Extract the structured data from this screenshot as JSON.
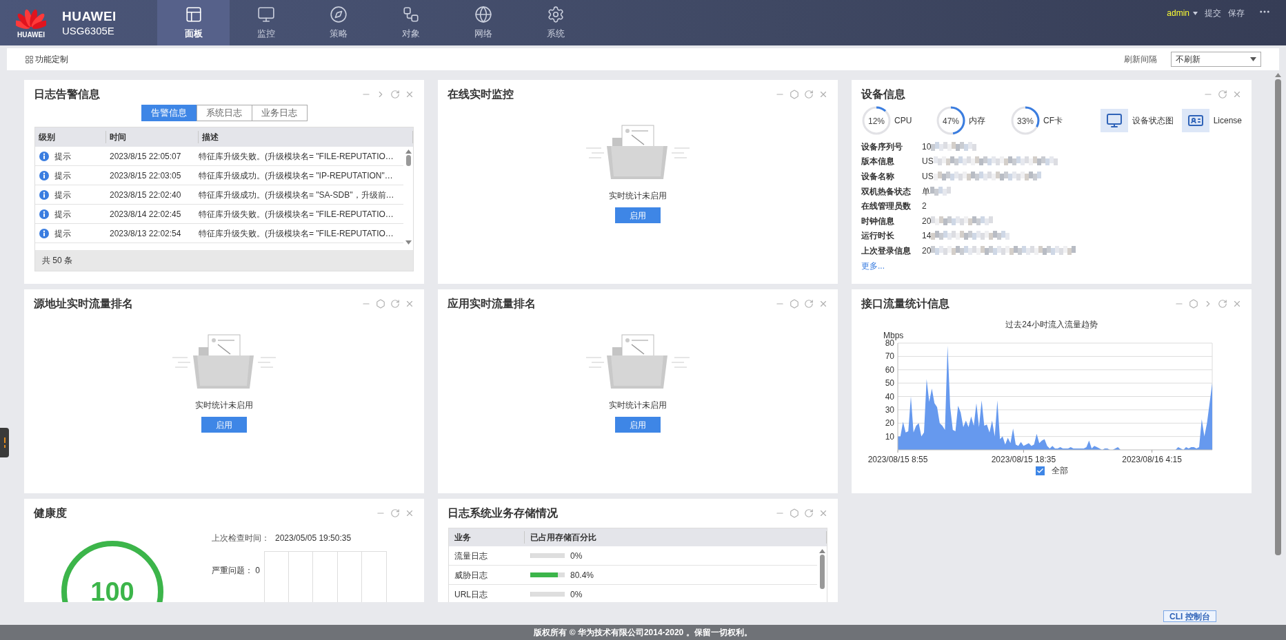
{
  "header": {
    "logo_caption": "HUAWEI",
    "brand": "HUAWEI",
    "model": "USG6305E",
    "nav": [
      {
        "label": "面板",
        "kind": "dashboard",
        "selected": true
      },
      {
        "label": "监控",
        "kind": "monitor",
        "selected": false
      },
      {
        "label": "策略",
        "kind": "policy",
        "selected": false
      },
      {
        "label": "对象",
        "kind": "object",
        "selected": false
      },
      {
        "label": "网络",
        "kind": "network",
        "selected": false
      },
      {
        "label": "系统",
        "kind": "system",
        "selected": false
      }
    ],
    "user": "admin",
    "actions": [
      "提交",
      "保存"
    ]
  },
  "toolbar": {
    "customize": "功能定制",
    "refresh_label": "刷新间隔",
    "refresh_value": "不刷新"
  },
  "panels": [
    {
      "kind": "log",
      "title": "日志告警信息",
      "tools": [
        {
          "kind": "minimize"
        },
        {
          "kind": "next"
        },
        {
          "kind": "refresh"
        },
        {
          "kind": "close"
        }
      ],
      "tabs": [
        {
          "label": "告警信息",
          "selected": true
        },
        {
          "label": "系统日志",
          "selected": false
        },
        {
          "label": "业务日志",
          "selected": false
        }
      ],
      "columns": [
        "级别",
        "时间",
        "描述"
      ],
      "rows": [
        {
          "level": "提示",
          "time": "2023/8/15 22:05:07",
          "description": "特征库升级失败。(升级模块名= \"FILE-REPUTATIO…"
        },
        {
          "level": "提示",
          "time": "2023/8/15 22:03:05",
          "description": "特征库升级成功。(升级模块名= \"IP-REPUTATION\"…"
        },
        {
          "level": "提示",
          "time": "2023/8/15 22:02:40",
          "description": "特征库升级成功。(升级模块名= \"SA-SDB\"，升级前…"
        },
        {
          "level": "提示",
          "time": "2023/8/14 22:02:45",
          "description": "特征库升级失败。(升级模块名= \"FILE-REPUTATIO…"
        },
        {
          "level": "提示",
          "time": "2023/8/13 22:02:54",
          "description": "特征库升级失败。(升级模块名= \"FILE-REPUTATIO…"
        }
      ],
      "total": "共 50 条"
    },
    {
      "kind": "empty",
      "title": "在线实时监控",
      "tools": [
        {
          "kind": "minimize"
        },
        {
          "kind": "settings"
        },
        {
          "kind": "refresh"
        },
        {
          "kind": "close"
        }
      ],
      "message": "实时统计未启用",
      "button": "启用"
    },
    {
      "kind": "device",
      "title": "设备信息",
      "tools": [
        {
          "kind": "minimize"
        },
        {
          "kind": "refresh"
        },
        {
          "kind": "close"
        }
      ],
      "gauges": [
        {
          "value": "12%",
          "label": "CPU",
          "level": 0.12
        },
        {
          "value": "47%",
          "label": "内存",
          "level": 0.47
        },
        {
          "value": "33%",
          "label": "CF卡",
          "level": 0.33
        }
      ],
      "shortcuts": [
        {
          "label": "设备状态图",
          "kind": "monitor"
        },
        {
          "label": "License",
          "kind": "license"
        }
      ],
      "info": [
        {
          "label": "设备序列号",
          "value": "10",
          "redacted": true
        },
        {
          "label": "版本信息",
          "value": "US",
          "redacted": true
        },
        {
          "label": "设备名称",
          "value": "US",
          "redacted": true
        },
        {
          "label": "双机热备状态",
          "value": "单",
          "redacted": true
        },
        {
          "label": "在线管理员数",
          "value": "2",
          "redacted": false
        },
        {
          "label": "时钟信息",
          "value": "20",
          "redacted": true
        },
        {
          "label": "运行时长",
          "value": "14",
          "redacted": true
        },
        {
          "label": "上次登录信息",
          "value": "20",
          "redacted": true
        }
      ],
      "more": "更多..."
    },
    {
      "kind": "empty",
      "title": "源地址实时流量排名",
      "tools": [
        {
          "kind": "minimize"
        },
        {
          "kind": "settings"
        },
        {
          "kind": "refresh"
        },
        {
          "kind": "close"
        }
      ],
      "message": "实时统计未启用",
      "button": "启用"
    },
    {
      "kind": "empty",
      "title": "应用实时流量排名",
      "tools": [
        {
          "kind": "minimize"
        },
        {
          "kind": "settings"
        },
        {
          "kind": "refresh"
        },
        {
          "kind": "close"
        }
      ],
      "message": "实时统计未启用",
      "button": "启用"
    },
    {
      "kind": "chart",
      "title": "接口流量统计信息",
      "tools": [
        {
          "kind": "minimize"
        },
        {
          "kind": "settings"
        },
        {
          "kind": "next"
        },
        {
          "kind": "refresh"
        },
        {
          "kind": "close"
        }
      ],
      "legend_checked": true,
      "chart_data": {
        "type": "area",
        "title": "过去24小时流入流量趋势",
        "ylabel": "Mbps",
        "ylim": [
          0,
          80
        ],
        "yticks": [
          10,
          20,
          30,
          40,
          50,
          60,
          70,
          80
        ],
        "grid": true,
        "categories": [
          "2023/08/15 8:55",
          null,
          null,
          null,
          null,
          null,
          null,
          null,
          null,
          null,
          null,
          null,
          null,
          null,
          null,
          null,
          null,
          null,
          null,
          null,
          null,
          null,
          null,
          null,
          null,
          null,
          null,
          null,
          null,
          null,
          null,
          null,
          null,
          null,
          null,
          null,
          null,
          null,
          null,
          null,
          null,
          null,
          null,
          null,
          null,
          null,
          null,
          null,
          "2023/08/15 18:35",
          null,
          null,
          null,
          null,
          null,
          null,
          null,
          null,
          null,
          null,
          null,
          null,
          null,
          null,
          null,
          null,
          null,
          null,
          null,
          null,
          null,
          null,
          null,
          null,
          null,
          null,
          null,
          null,
          null,
          null,
          null,
          null,
          null,
          null,
          null,
          null,
          null,
          null,
          null,
          null,
          null,
          null,
          null,
          null,
          null,
          null,
          null,
          null,
          "2023/08/16 4:15",
          null,
          null,
          null,
          null,
          null,
          null,
          null,
          null,
          null,
          null,
          null,
          null,
          null,
          null,
          null,
          null,
          null,
          null,
          null,
          null,
          null,
          null,
          null
        ],
        "series": [
          {
            "name": "全部",
            "color": "#6699ee",
            "values": [
              10,
              10,
              21,
              13,
              14,
              40,
              13,
              18,
              20,
              10,
              13,
              53,
              36,
              46,
              35,
              32,
              20,
              18,
              15,
              78,
              32,
              15,
              14,
              33,
              28,
              17,
              22,
              17,
              25,
              18,
              35,
              17,
              37,
              18,
              19,
              13,
              22,
              10,
              37,
              8,
              10,
              4,
              9,
              5,
              16,
              4,
              3,
              6,
              3,
              4,
              5,
              3,
              4,
              12,
              5,
              7,
              8,
              3,
              1,
              3,
              1,
              1,
              2,
              1,
              1,
              1,
              2,
              1,
              1,
              1,
              1,
              1,
              2,
              7,
              1,
              3,
              2,
              1,
              0,
              1,
              1,
              0,
              0,
              1,
              2,
              0,
              0,
              0,
              0,
              0,
              0,
              0,
              0,
              0,
              0,
              0,
              0,
              0,
              0,
              0,
              0,
              0,
              0,
              0,
              0,
              0,
              0,
              2,
              1,
              0,
              2,
              1,
              2,
              2,
              1,
              2,
              23,
              10,
              20,
              35,
              50
            ]
          }
        ]
      }
    },
    {
      "kind": "health",
      "title": "健康度",
      "tools": [
        {
          "kind": "minimize"
        },
        {
          "kind": "refresh"
        },
        {
          "kind": "close"
        }
      ],
      "score": "100",
      "check_label": "上次检查时间：",
      "check_time": "2023/05/05 19:50:35",
      "issues": [
        {
          "label": "严重问题：",
          "count": "0"
        }
      ]
    },
    {
      "kind": "storage",
      "title": "日志系统业务存储情况",
      "tools": [
        {
          "kind": "minimize"
        },
        {
          "kind": "settings"
        },
        {
          "kind": "refresh"
        },
        {
          "kind": "close"
        }
      ],
      "columns": [
        "业务",
        "已占用存储百分比"
      ],
      "rows": [
        {
          "name": "流量日志",
          "level": 0,
          "value": "0%"
        },
        {
          "name": "威胁日志",
          "level": 0.804,
          "value": "80.4%"
        },
        {
          "name": "URL日志",
          "level": 0,
          "value": "0%"
        }
      ]
    }
  ],
  "cli_button": "CLI 控制台",
  "footer": "版权所有 © 华为技术有限公司2014-2020 。保留一切权利。"
}
